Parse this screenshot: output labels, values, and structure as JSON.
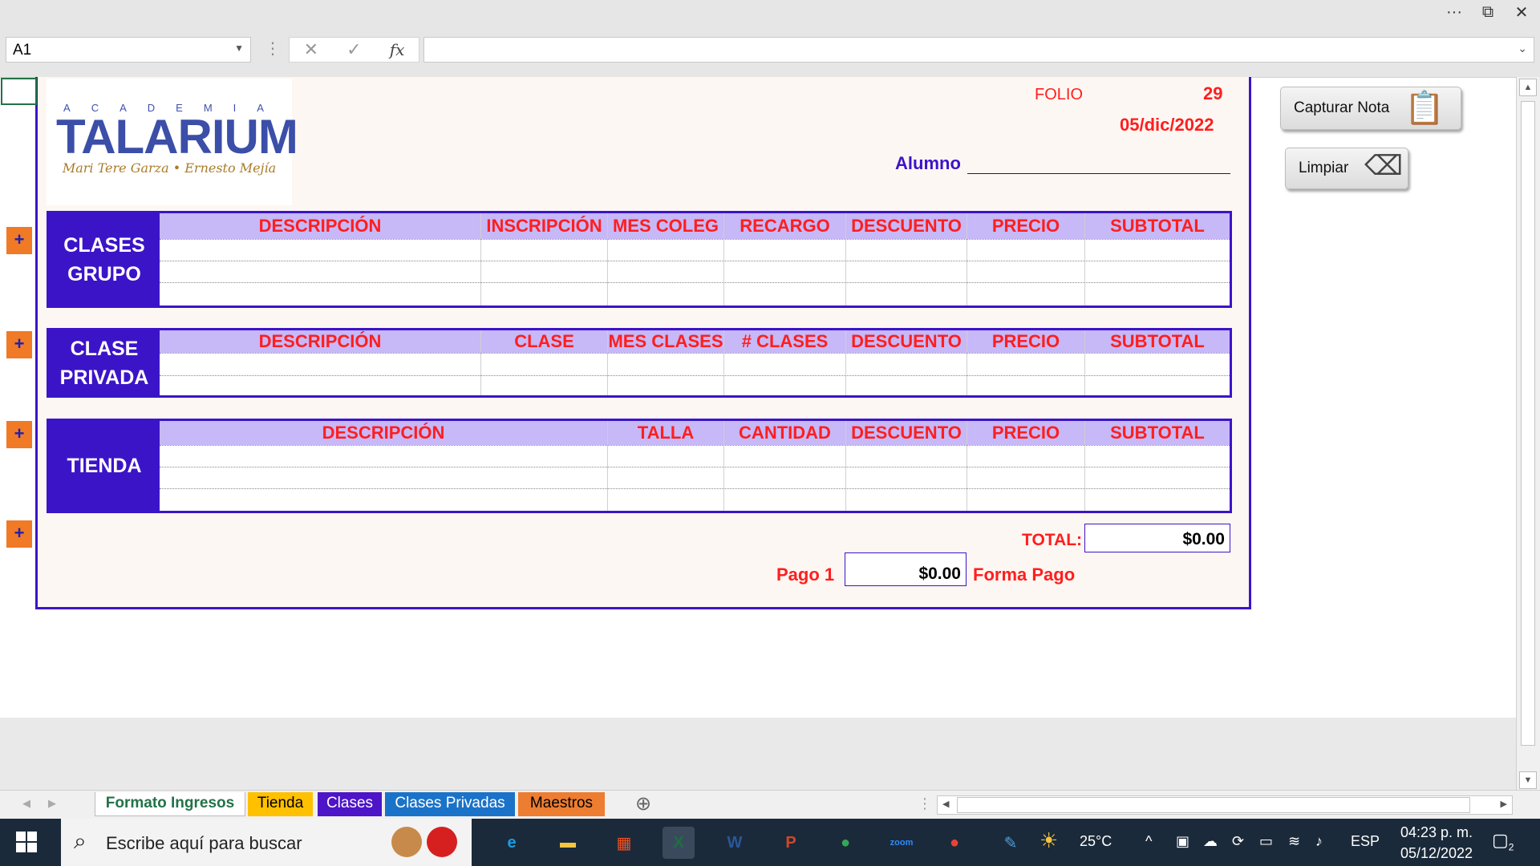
{
  "window": {
    "more_glyph": "···",
    "restore_glyph": "⧉",
    "close_glyph": "✕"
  },
  "formula_bar": {
    "name_box": "A1",
    "cancel_glyph": "✕",
    "enter_glyph": "✓",
    "fx_label": "fx",
    "formula": ""
  },
  "logo": {
    "academia": "ACADEMIA",
    "title": "TALARIUM",
    "names": "Mari Tere Garza • Ernesto Mejía"
  },
  "header": {
    "folio_label": "FOLIO",
    "folio_value": "29",
    "date": "05/dic/2022",
    "alumno_label": "Alumno"
  },
  "macro_buttons": {
    "capturar": "Capturar Nota",
    "limpiar": "Limpiar",
    "capturar_icon": "📋",
    "limpiar_icon": "⌫"
  },
  "plus_glyph": "+",
  "sections": {
    "grupo": {
      "title_line1": "CLASES",
      "title_line2": "GRUPO",
      "columns": [
        "DESCRIPCIÓN",
        "INSCRIPCIÓN",
        "MES COLEG",
        "RECARGO",
        "DESCUENTO",
        "PRECIO",
        "SUBTOTAL"
      ]
    },
    "privada": {
      "title_line1": "CLASE",
      "title_line2": "PRIVADA",
      "columns": [
        "DESCRIPCIÓN",
        "CLASE",
        "MES CLASES",
        "# CLASES",
        "DESCUENTO",
        "PRECIO",
        "SUBTOTAL"
      ]
    },
    "tienda": {
      "title": "TIENDA",
      "columns": [
        "DESCRIPCIÓN",
        "TALLA",
        "CANTIDAD",
        "DESCUENTO",
        "PRECIO",
        "SUBTOTAL"
      ]
    }
  },
  "totals": {
    "total_label": "TOTAL:",
    "total_value": "$0.00",
    "pago_label": "Pago 1",
    "pago_value": "$0.00",
    "forma_label": "Forma Pago"
  },
  "sheet_tabs": [
    {
      "label": "Formato Ingresos",
      "color": "#ffffff",
      "text_color": "#217346"
    },
    {
      "label": "Tienda",
      "color": "#ffc000",
      "text_color": "#000000"
    },
    {
      "label": "Clases",
      "color": "#4d14c8",
      "text_color": "#ffffff"
    },
    {
      "label": "Clases Privadas",
      "color": "#1a73c8",
      "text_color": "#ffffff"
    },
    {
      "label": "Maestros",
      "color": "#ed7d31",
      "text_color": "#000000"
    }
  ],
  "add_sheet_glyph": "⊕",
  "taskbar": {
    "search_placeholder": "Escribe aquí para buscar",
    "search_glyph": "⌕",
    "apps": [
      {
        "icon": "edge-icon",
        "glyph": "e",
        "color": "#1b9de2"
      },
      {
        "icon": "file-explorer-icon",
        "glyph": "▬",
        "color": "#f4c542"
      },
      {
        "icon": "store-icon",
        "glyph": "▦",
        "color": "#f25022"
      },
      {
        "icon": "excel-icon",
        "glyph": "X",
        "color": "#1d6f42"
      },
      {
        "icon": "word-icon",
        "glyph": "W",
        "color": "#2b579a"
      },
      {
        "icon": "powerpoint-icon",
        "glyph": "P",
        "color": "#d24726"
      },
      {
        "icon": "chrome-icon",
        "glyph": "●",
        "color": "#34a853"
      },
      {
        "icon": "zoom-icon",
        "glyph": "zoom",
        "color": "#2d8cff"
      },
      {
        "icon": "chrome-profile-icon",
        "glyph": "●",
        "color": "#ea4335"
      },
      {
        "icon": "paint-icon",
        "glyph": "✎",
        "color": "#4aa3df"
      }
    ],
    "weather": "25°C",
    "lang": "ESP",
    "time": "04:23 p. m.",
    "date": "05/12/2022",
    "notifications": "2"
  }
}
